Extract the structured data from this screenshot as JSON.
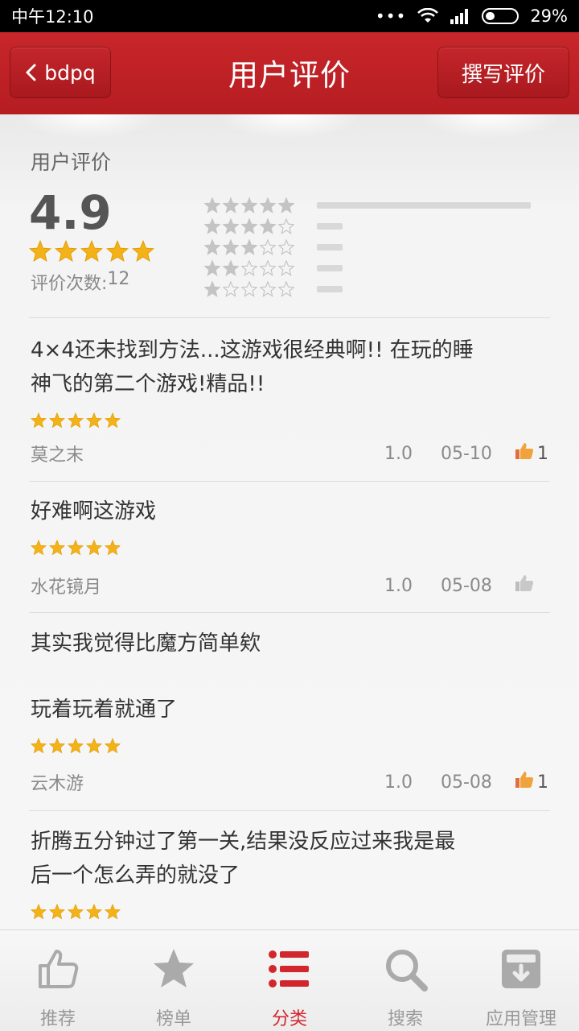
{
  "status_bar": {
    "time": "中午12:10",
    "dots": "•••",
    "battery": "29%",
    "battery_level": 0.29
  },
  "header": {
    "back_label": "bdpq",
    "title": "用户评价",
    "write_label": "撰写评价"
  },
  "summary": {
    "section_label": "用户评价",
    "score": "4.9",
    "score_stars": 5,
    "count_label": "评价次数:",
    "count_value": "12",
    "distribution": [
      {
        "stars": 5,
        "fraction": 1.0
      },
      {
        "stars": 4,
        "fraction": 0.12
      },
      {
        "stars": 3,
        "fraction": 0.12
      },
      {
        "stars": 2,
        "fraction": 0.12
      },
      {
        "stars": 1,
        "fraction": 0.12
      }
    ]
  },
  "reviews": [
    {
      "text_lines": [
        "4×4还未找到方法...这游戏很经典啊!! 在玩的睡",
        "神飞的第二个游戏!精品!!"
      ],
      "stars": 5,
      "author": "莫之末",
      "version": "1.0",
      "date": "05-10",
      "likes": "1",
      "liked": true
    },
    {
      "text_lines": [
        "好难啊这游戏"
      ],
      "stars": 5,
      "author": "水花镜月",
      "version": "1.0",
      "date": "05-08",
      "likes": "",
      "liked": false
    },
    {
      "text_lines": [
        "其实我觉得比魔方简单欸",
        "",
        "玩着玩着就通了"
      ],
      "stars": 5,
      "author": "云木游",
      "version": "1.0",
      "date": "05-08",
      "likes": "1",
      "liked": true
    },
    {
      "text_lines": [
        "折腾五分钟过了第一关,结果没反应过来我是最",
        "后一个怎么弄的就没了"
      ],
      "stars": 5,
      "author": "",
      "version": "",
      "date": "",
      "likes": "",
      "liked": false
    }
  ],
  "bottom_nav": [
    {
      "label": "推荐",
      "icon": "thumbs-up-icon",
      "active": false
    },
    {
      "label": "榜单",
      "icon": "star-icon",
      "active": false
    },
    {
      "label": "分类",
      "icon": "list-icon",
      "active": true
    },
    {
      "label": "搜索",
      "icon": "search-icon",
      "active": false
    },
    {
      "label": "应用管理",
      "icon": "download-box-icon",
      "active": false
    }
  ],
  "colors": {
    "header_red": "#c8262a",
    "active_red": "#d2262d",
    "star_gold": "#f3b318"
  }
}
